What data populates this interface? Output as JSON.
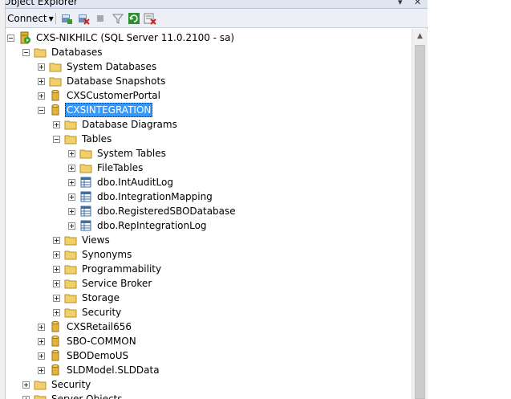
{
  "window": {
    "title": "Object Explorer",
    "pin_icon": "pin-icon",
    "close_icon": "close-icon"
  },
  "toolbar": {
    "connect_label": "Connect",
    "buttons": [
      "connect-object-explorer-icon",
      "disconnect-icon",
      "stop-icon",
      "filter-icon",
      "refresh-icon",
      "summary-icon"
    ]
  },
  "tree": {
    "server": "CXS-NIKHILC (SQL Server 11.0.2100 - sa)",
    "databases": "Databases",
    "system_databases": "System Databases",
    "database_snapshots": "Database Snapshots",
    "cxs_customer_portal": "CXSCustomerPortal",
    "cxs_integration": "CXSINTEGRATION",
    "database_diagrams": "Database Diagrams",
    "tables": "Tables",
    "system_tables": "System Tables",
    "file_tables": "FileTables",
    "table_1": "dbo.IntAuditLog",
    "table_2": "dbo.IntegrationMapping",
    "table_3": "dbo.RegisteredSBODatabase",
    "table_4": "dbo.RepIntegrationLog",
    "views": "Views",
    "synonyms": "Synonyms",
    "programmability": "Programmability",
    "service_broker": "Service Broker",
    "storage": "Storage",
    "security_db": "Security",
    "cxs_retail": "CXSRetail656",
    "sbo_common": "SBO-COMMON",
    "sbo_demo_us": "SBODemoUS",
    "sld_model": "SLDModel.SLDData",
    "security_server": "Security",
    "server_objects": "Server Objects"
  },
  "colors": {
    "selection": "#3399ff",
    "folder": "#e8c05a",
    "database": "#e3b43a",
    "table": "#3a6ea5"
  }
}
